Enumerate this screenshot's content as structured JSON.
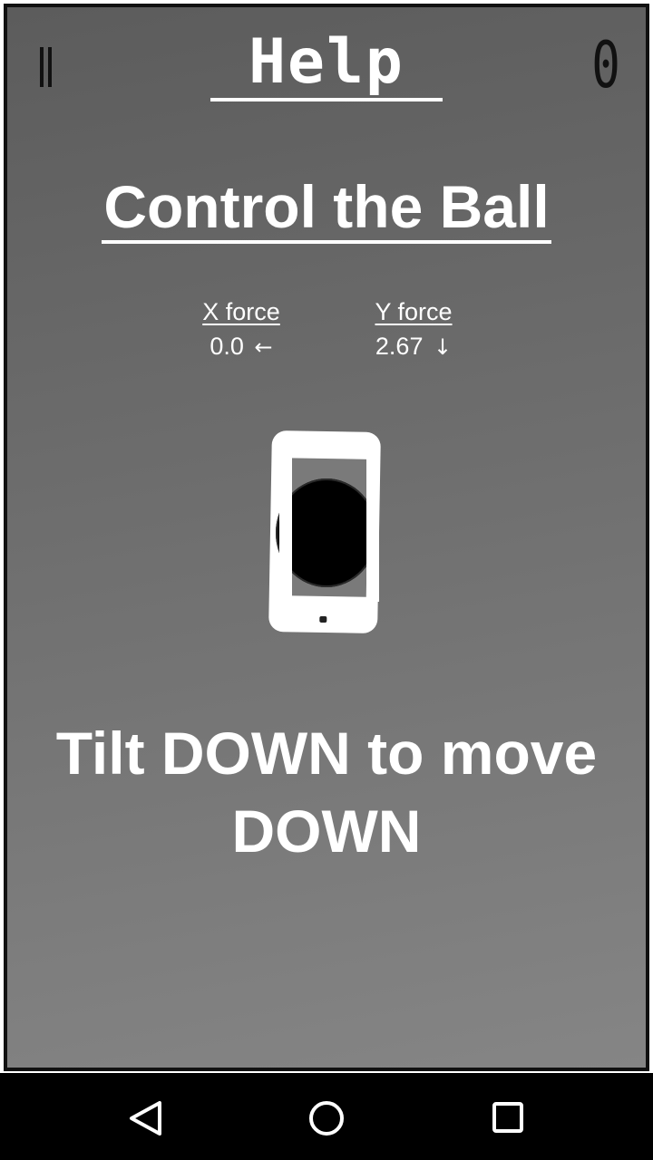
{
  "header": {
    "title": "Help",
    "score": "0"
  },
  "section": {
    "title": "Control the Ball"
  },
  "forces": {
    "x": {
      "label": "X force",
      "value": "0.0",
      "arrow": "←"
    },
    "y": {
      "label": "Y force",
      "value": "2.67",
      "arrow": "↓"
    }
  },
  "instruction": {
    "text": "Tilt DOWN to move DOWN"
  },
  "icons": {
    "pause": "pause-icon",
    "phone": "phone-icon",
    "ball": "ball-icon",
    "back": "back-triangle-icon",
    "home": "home-circle-icon",
    "recent": "recent-square-icon"
  },
  "colors": {
    "background_top": "#5c5c5c",
    "background_bottom": "#858585",
    "text": "#ffffff",
    "frame": "#111111",
    "navbar": "#000000"
  }
}
